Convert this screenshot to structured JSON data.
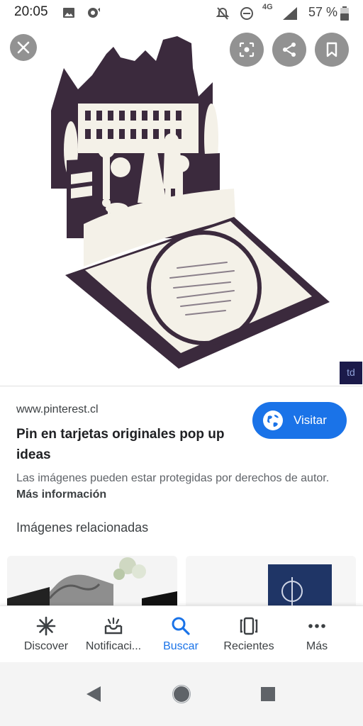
{
  "status_bar": {
    "time": "20:05",
    "network": "4G",
    "battery": "57 %"
  },
  "hero": {
    "watermark": "td",
    "colors": {
      "card_dark": "#3b2a3d",
      "card_light": "#f4f1e8"
    }
  },
  "result": {
    "source": "www.pinterest.cl",
    "title": "Pin en tarjetas originales pop up ideas",
    "visit_label": "Visitar",
    "copyright_text": "Las imágenes pueden estar protegidas por derechos de autor.",
    "more_info_label": "Más información"
  },
  "related": {
    "heading": "Imágenes relacionadas"
  },
  "bottom_nav": {
    "items": [
      {
        "label": "Discover",
        "icon": "asterisk-icon"
      },
      {
        "label": "Notificaci...",
        "icon": "notification-tray-icon"
      },
      {
        "label": "Buscar",
        "icon": "search-icon",
        "active": true
      },
      {
        "label": "Recientes",
        "icon": "recent-cards-icon"
      },
      {
        "label": "Más",
        "icon": "more-dots-icon"
      }
    ]
  },
  "colors": {
    "accent": "#1a73e8",
    "text_primary": "#202124",
    "text_secondary": "#5f6368"
  }
}
